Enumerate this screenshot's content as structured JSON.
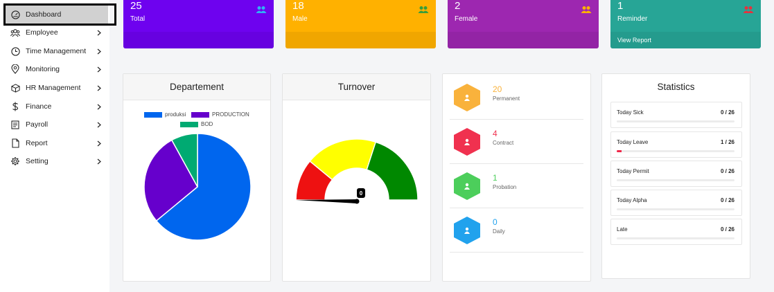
{
  "sidebar": {
    "items": [
      {
        "label": "Dashboard",
        "icon": "gauge-icon",
        "active": true
      },
      {
        "label": "Employee",
        "icon": "users-icon"
      },
      {
        "label": "Time Management",
        "icon": "clock-icon"
      },
      {
        "label": "Monitoring",
        "icon": "location-pin-icon"
      },
      {
        "label": "HR Management",
        "icon": "cube-icon"
      },
      {
        "label": "Finance",
        "icon": "dollar-icon"
      },
      {
        "label": "Payroll",
        "icon": "receipt-icon"
      },
      {
        "label": "Report",
        "icon": "document-icon"
      },
      {
        "label": "Setting",
        "icon": "gear-icon"
      }
    ]
  },
  "cards": [
    {
      "value": "25",
      "label": "Total",
      "color": "#6e02ef",
      "icon_color": "#31b0f5"
    },
    {
      "value": "18",
      "label": "Male",
      "color": "#ffb100",
      "icon_color": "#3a9d3a"
    },
    {
      "value": "2",
      "label": "Female",
      "color": "#9d27b0",
      "icon_color": "#ffb100"
    },
    {
      "value": "1",
      "label": "Reminder",
      "color": "#27a596",
      "icon_color": "#e5323f",
      "link": "View Report"
    }
  ],
  "departement": {
    "title": "Departement",
    "chart_data": {
      "type": "pie",
      "categories": [
        "produksi",
        "PRODUCTION",
        "BOD"
      ],
      "values": [
        16,
        7,
        2
      ],
      "colors": [
        "#0066ee",
        "#6600cc",
        "#00aa72"
      ],
      "legend_position": "top"
    }
  },
  "turnover": {
    "title": "Turnover",
    "chart_data": {
      "type": "gauge",
      "value": 0,
      "value_label": "0",
      "bands": [
        {
          "from": 0,
          "to": 0.22,
          "color": "#ee1111"
        },
        {
          "from": 0.22,
          "to": 0.6,
          "color": "#ffff00"
        },
        {
          "from": 0.6,
          "to": 1,
          "color": "#008800"
        }
      ]
    }
  },
  "types": [
    {
      "value": "20",
      "label": "Permanent",
      "color": "#f9b23c"
    },
    {
      "value": "4",
      "label": "Contract",
      "color": "#f0314f"
    },
    {
      "value": "1",
      "label": "Probation",
      "color": "#4cce5b"
    },
    {
      "value": "0",
      "label": "Daily",
      "color": "#21a2ed"
    }
  ],
  "statistics": {
    "title": "Statistics",
    "rows": [
      {
        "label": "Today Sick",
        "value": "0 / 26",
        "fraction": 0
      },
      {
        "label": "Today Leave",
        "value": "1 / 26",
        "fraction": 0.0385
      },
      {
        "label": "Today Permit",
        "value": "0 / 26",
        "fraction": 0
      },
      {
        "label": "Today Alpha",
        "value": "0 / 26",
        "fraction": 0
      },
      {
        "label": "Late",
        "value": "0 / 26",
        "fraction": 0
      }
    ]
  }
}
